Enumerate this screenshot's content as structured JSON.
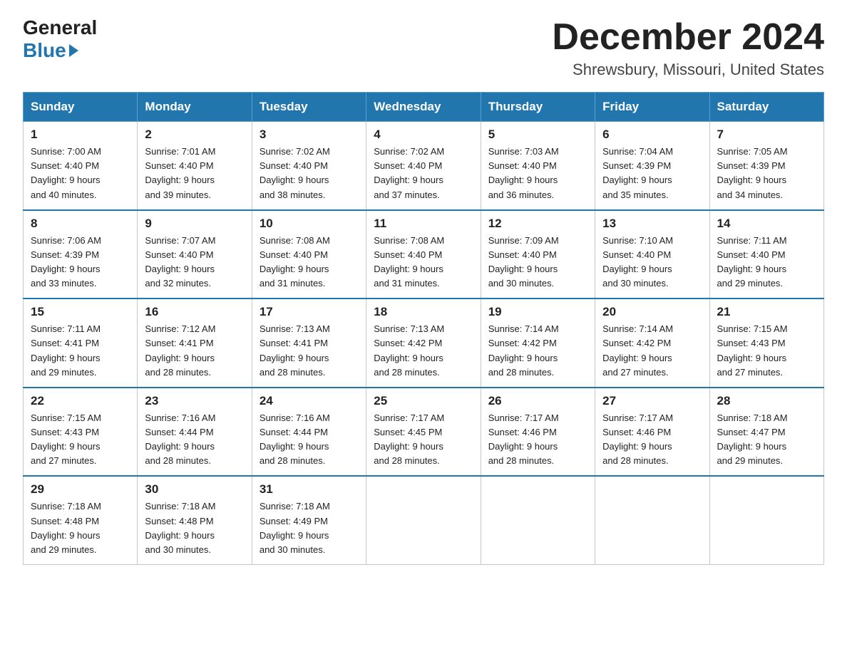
{
  "header": {
    "logo_general": "General",
    "logo_blue": "Blue",
    "month_title": "December 2024",
    "location": "Shrewsbury, Missouri, United States"
  },
  "days_of_week": [
    "Sunday",
    "Monday",
    "Tuesday",
    "Wednesday",
    "Thursday",
    "Friday",
    "Saturday"
  ],
  "weeks": [
    [
      {
        "day": "1",
        "sunrise": "7:00 AM",
        "sunset": "4:40 PM",
        "daylight": "9 hours and 40 minutes."
      },
      {
        "day": "2",
        "sunrise": "7:01 AM",
        "sunset": "4:40 PM",
        "daylight": "9 hours and 39 minutes."
      },
      {
        "day": "3",
        "sunrise": "7:02 AM",
        "sunset": "4:40 PM",
        "daylight": "9 hours and 38 minutes."
      },
      {
        "day": "4",
        "sunrise": "7:02 AM",
        "sunset": "4:40 PM",
        "daylight": "9 hours and 37 minutes."
      },
      {
        "day": "5",
        "sunrise": "7:03 AM",
        "sunset": "4:40 PM",
        "daylight": "9 hours and 36 minutes."
      },
      {
        "day": "6",
        "sunrise": "7:04 AM",
        "sunset": "4:39 PM",
        "daylight": "9 hours and 35 minutes."
      },
      {
        "day": "7",
        "sunrise": "7:05 AM",
        "sunset": "4:39 PM",
        "daylight": "9 hours and 34 minutes."
      }
    ],
    [
      {
        "day": "8",
        "sunrise": "7:06 AM",
        "sunset": "4:39 PM",
        "daylight": "9 hours and 33 minutes."
      },
      {
        "day": "9",
        "sunrise": "7:07 AM",
        "sunset": "4:40 PM",
        "daylight": "9 hours and 32 minutes."
      },
      {
        "day": "10",
        "sunrise": "7:08 AM",
        "sunset": "4:40 PM",
        "daylight": "9 hours and 31 minutes."
      },
      {
        "day": "11",
        "sunrise": "7:08 AM",
        "sunset": "4:40 PM",
        "daylight": "9 hours and 31 minutes."
      },
      {
        "day": "12",
        "sunrise": "7:09 AM",
        "sunset": "4:40 PM",
        "daylight": "9 hours and 30 minutes."
      },
      {
        "day": "13",
        "sunrise": "7:10 AM",
        "sunset": "4:40 PM",
        "daylight": "9 hours and 30 minutes."
      },
      {
        "day": "14",
        "sunrise": "7:11 AM",
        "sunset": "4:40 PM",
        "daylight": "9 hours and 29 minutes."
      }
    ],
    [
      {
        "day": "15",
        "sunrise": "7:11 AM",
        "sunset": "4:41 PM",
        "daylight": "9 hours and 29 minutes."
      },
      {
        "day": "16",
        "sunrise": "7:12 AM",
        "sunset": "4:41 PM",
        "daylight": "9 hours and 28 minutes."
      },
      {
        "day": "17",
        "sunrise": "7:13 AM",
        "sunset": "4:41 PM",
        "daylight": "9 hours and 28 minutes."
      },
      {
        "day": "18",
        "sunrise": "7:13 AM",
        "sunset": "4:42 PM",
        "daylight": "9 hours and 28 minutes."
      },
      {
        "day": "19",
        "sunrise": "7:14 AM",
        "sunset": "4:42 PM",
        "daylight": "9 hours and 28 minutes."
      },
      {
        "day": "20",
        "sunrise": "7:14 AM",
        "sunset": "4:42 PM",
        "daylight": "9 hours and 27 minutes."
      },
      {
        "day": "21",
        "sunrise": "7:15 AM",
        "sunset": "4:43 PM",
        "daylight": "9 hours and 27 minutes."
      }
    ],
    [
      {
        "day": "22",
        "sunrise": "7:15 AM",
        "sunset": "4:43 PM",
        "daylight": "9 hours and 27 minutes."
      },
      {
        "day": "23",
        "sunrise": "7:16 AM",
        "sunset": "4:44 PM",
        "daylight": "9 hours and 28 minutes."
      },
      {
        "day": "24",
        "sunrise": "7:16 AM",
        "sunset": "4:44 PM",
        "daylight": "9 hours and 28 minutes."
      },
      {
        "day": "25",
        "sunrise": "7:17 AM",
        "sunset": "4:45 PM",
        "daylight": "9 hours and 28 minutes."
      },
      {
        "day": "26",
        "sunrise": "7:17 AM",
        "sunset": "4:46 PM",
        "daylight": "9 hours and 28 minutes."
      },
      {
        "day": "27",
        "sunrise": "7:17 AM",
        "sunset": "4:46 PM",
        "daylight": "9 hours and 28 minutes."
      },
      {
        "day": "28",
        "sunrise": "7:18 AM",
        "sunset": "4:47 PM",
        "daylight": "9 hours and 29 minutes."
      }
    ],
    [
      {
        "day": "29",
        "sunrise": "7:18 AM",
        "sunset": "4:48 PM",
        "daylight": "9 hours and 29 minutes."
      },
      {
        "day": "30",
        "sunrise": "7:18 AM",
        "sunset": "4:48 PM",
        "daylight": "9 hours and 30 minutes."
      },
      {
        "day": "31",
        "sunrise": "7:18 AM",
        "sunset": "4:49 PM",
        "daylight": "9 hours and 30 minutes."
      },
      null,
      null,
      null,
      null
    ]
  ],
  "labels": {
    "sunrise": "Sunrise:",
    "sunset": "Sunset:",
    "daylight": "Daylight:"
  }
}
